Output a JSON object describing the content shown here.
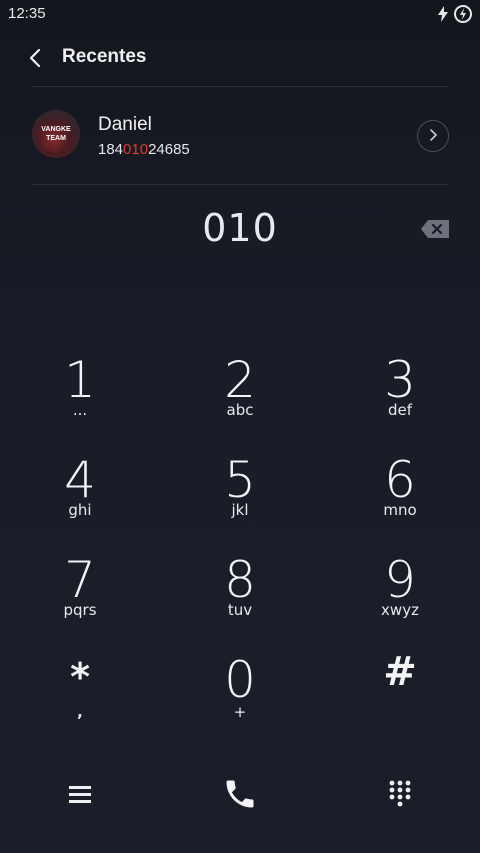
{
  "status_bar": {
    "time": "12:35",
    "icons": [
      "charging-bolt-icon",
      "battery-circle-icon"
    ]
  },
  "header": {
    "back_icon": "chevron-left-icon",
    "title": "Recentes"
  },
  "contact": {
    "avatar_text_line1": "VANGKE",
    "avatar_text_line2": "TEAM",
    "name": "Daniel",
    "number_prefix": "184",
    "number_match": "010",
    "number_suffix": "24685",
    "detail_icon": "chevron-right-circle-icon"
  },
  "dialer": {
    "entered_number": "010",
    "backspace_icon": "backspace-icon"
  },
  "keypad": [
    {
      "digit": "1",
      "letters": "..."
    },
    {
      "digit": "2",
      "letters": "abc"
    },
    {
      "digit": "3",
      "letters": "def"
    },
    {
      "digit": "4",
      "letters": "ghi"
    },
    {
      "digit": "5",
      "letters": "jkl"
    },
    {
      "digit": "6",
      "letters": "mno"
    },
    {
      "digit": "7",
      "letters": "pqrs"
    },
    {
      "digit": "8",
      "letters": "tuv"
    },
    {
      "digit": "9",
      "letters": "xwyz"
    },
    {
      "digit": "*",
      "letters": ","
    },
    {
      "digit": "0",
      "letters": "+"
    },
    {
      "digit": "#",
      "letters": ""
    }
  ],
  "bottom_bar": {
    "menu_icon": "menu-icon",
    "call_icon": "phone-call-icon",
    "dialpad_icon": "dialpad-icon"
  },
  "colors": {
    "accent_match": "#e03a2f",
    "background": "#1a1d28"
  }
}
